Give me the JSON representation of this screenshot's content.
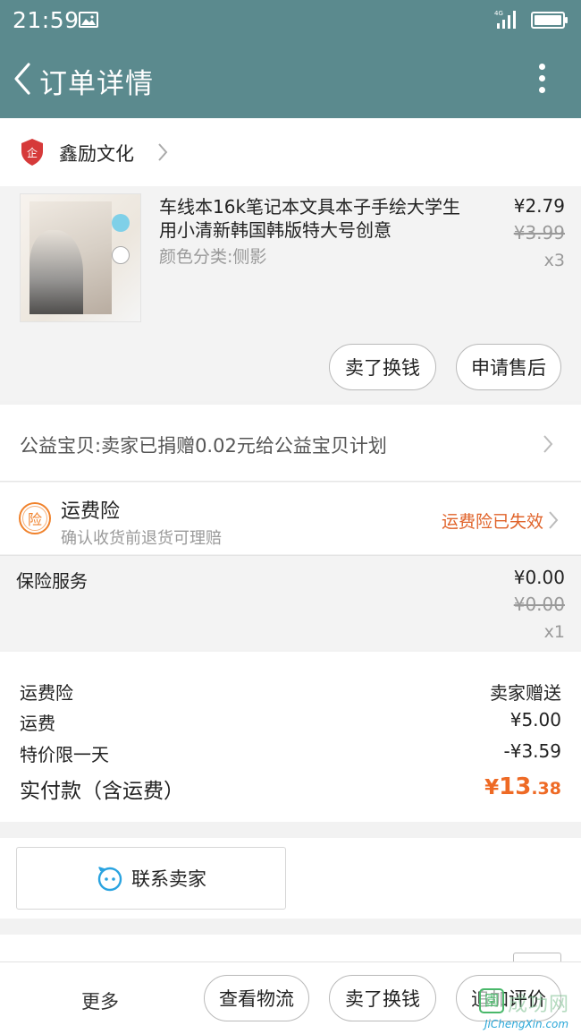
{
  "status_bar": {
    "time": "21:59",
    "network": "4G"
  },
  "header": {
    "title": "订单详情"
  },
  "store": {
    "name": "鑫励文化",
    "badge": "企"
  },
  "product": {
    "title": "车线本16k笔记本文具本子手绘大学生用小清新韩国韩版特大号创意",
    "variant": "颜色分类:侧影",
    "price": "¥2.79",
    "original_price": "¥3.99",
    "quantity": "x3",
    "sell_button": "卖了换钱",
    "after_sale_button": "申请售后"
  },
  "charity": {
    "text": "公益宝贝:卖家已捐赠0.02元给公益宝贝计划"
  },
  "shipping_insurance": {
    "icon_char": "险",
    "title": "运费险",
    "subtitle": "确认收货前退货可理赔",
    "status": "运费险已失效",
    "status_color": "#e0632a"
  },
  "insurance_service": {
    "label": "保险服务",
    "price": "¥0.00",
    "original_price": "¥0.00",
    "quantity": "x1"
  },
  "totals": {
    "rows": [
      {
        "label": "运费险",
        "value": "卖家赠送"
      },
      {
        "label": "运费",
        "value": "¥5.00"
      },
      {
        "label": "特价限一天",
        "value": "-¥3.59"
      }
    ],
    "pay_label": "实付款（含运费）",
    "pay_currency": "¥",
    "pay_integer": "13",
    "pay_decimal": ".38",
    "accent_color": "#ee6a25"
  },
  "contact": {
    "label": "联系卖家"
  },
  "bottom_bar": {
    "more": "更多",
    "logistics": "查看物流",
    "sell": "卖了换钱",
    "review": "追加评价"
  },
  "watermark": {
    "text": "成功网",
    "url": "JiChengXin.com"
  },
  "colors": {
    "primary": "#5b8a8e",
    "background": "#f2f2f2"
  }
}
